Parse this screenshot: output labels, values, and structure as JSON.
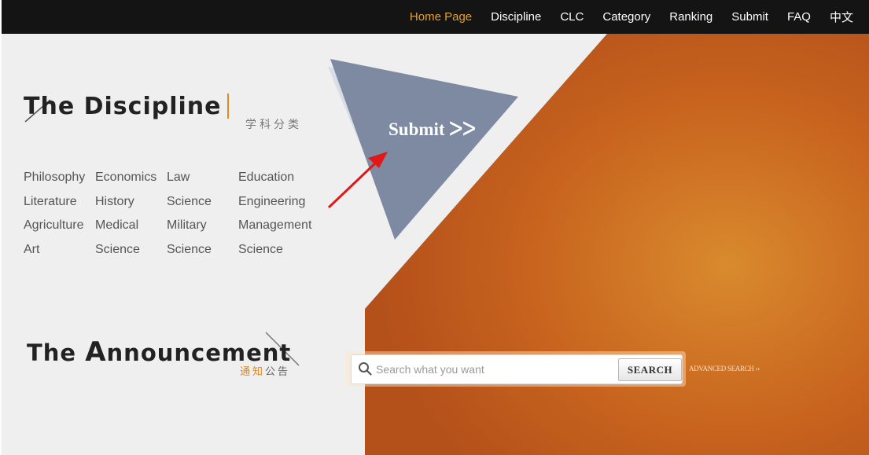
{
  "nav": {
    "items": [
      {
        "label": "Home Page",
        "active": true
      },
      {
        "label": "Discipline"
      },
      {
        "label": "CLC"
      },
      {
        "label": "Category"
      },
      {
        "label": "Ranking"
      },
      {
        "label": "Submit"
      },
      {
        "label": "FAQ"
      },
      {
        "label": "中文"
      }
    ]
  },
  "discipline": {
    "title": "The Discipline",
    "subtitle": "学科分类",
    "links": [
      "Philosophy",
      "Economics",
      "Law",
      "Education",
      "Literature",
      "History",
      "Science",
      "Engineering",
      "Agriculture",
      "Medical",
      "Military",
      "Management",
      "Art",
      "Science",
      "Science",
      "Science"
    ]
  },
  "submit": {
    "label": "Submit ᐳᐳ"
  },
  "announcement": {
    "title_prefix": "The ",
    "title_big": "A",
    "title_rest": "nnouncement",
    "subtitle_hl": "通知",
    "subtitle_rest": "公告"
  },
  "search": {
    "placeholder": "Search what you want",
    "value": "",
    "button_label": "SEARCH",
    "advanced_label": "ADVANCED SEARCH ››"
  },
  "colors": {
    "nav_bg": "#141414",
    "nav_active": "#e8a020",
    "orange": "#c8641e",
    "triangle": "#7e8aa2",
    "arrow": "#e01818"
  },
  "icons": {
    "search": "search-icon",
    "arrow": "red-arrow-icon"
  }
}
